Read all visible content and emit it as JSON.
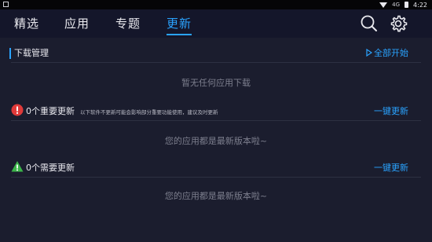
{
  "status_bar": {
    "time": "4:22",
    "signal_label": "4G"
  },
  "tabs": [
    {
      "label": "精选",
      "active": false
    },
    {
      "label": "应用",
      "active": false
    },
    {
      "label": "专题",
      "active": false
    },
    {
      "label": "更新",
      "active": true
    }
  ],
  "icons": {
    "search": "search-icon",
    "settings": "gear-icon"
  },
  "download_manager": {
    "title": "下载管理",
    "start_all_label": "全部开始",
    "empty_text": "暂无任何应用下载"
  },
  "important_updates": {
    "title": "0个重要更新",
    "description": "以下软件不更新可能会影响部分重要功能使用，建议及时更新",
    "update_all_label": "一键更新",
    "empty_text": "您的应用都是最新版本啦~"
  },
  "needed_updates": {
    "title": "0个需要更新",
    "update_all_label": "一键更新",
    "empty_text": "您的应用都是最新版本啦~"
  },
  "colors": {
    "accent": "#2aa3ff",
    "background": "#1b1d2e",
    "warning_red": "#e03a3a",
    "warning_green": "#3cb54a"
  }
}
